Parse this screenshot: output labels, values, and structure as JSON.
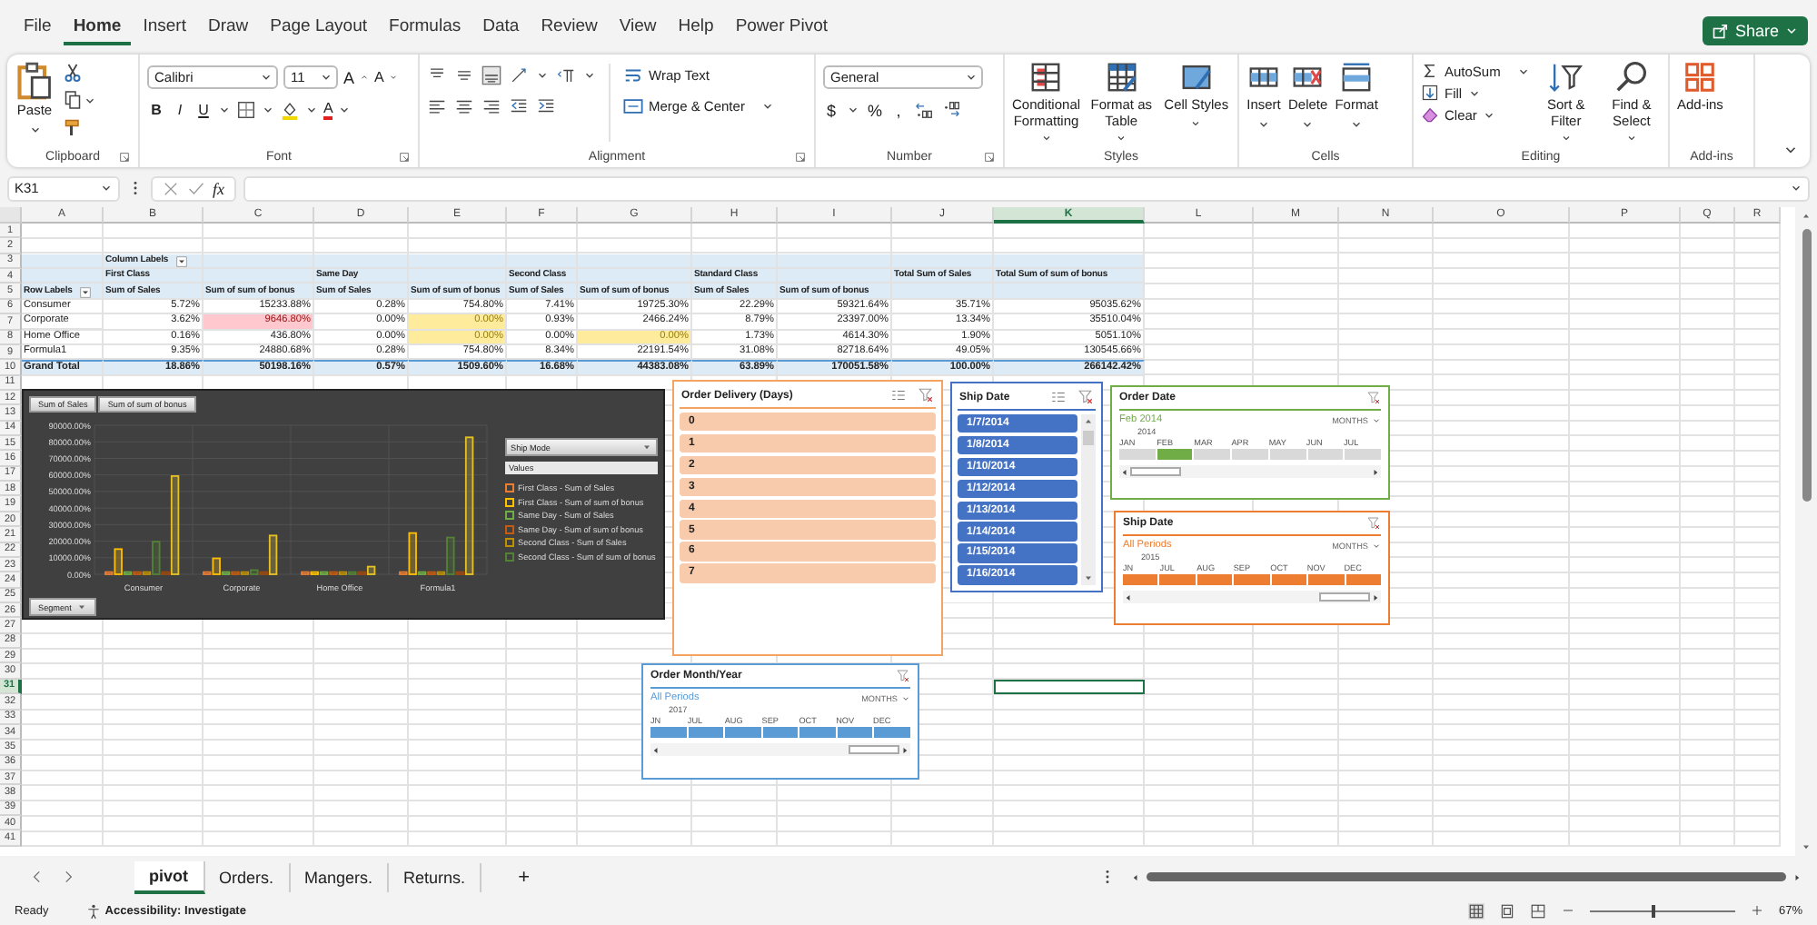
{
  "menu_tabs": [
    {
      "label": "File",
      "selected": false
    },
    {
      "label": "Home",
      "selected": true
    },
    {
      "label": "Insert",
      "selected": false
    },
    {
      "label": "Draw",
      "selected": false
    },
    {
      "label": "Page Layout",
      "selected": false
    },
    {
      "label": "Formulas",
      "selected": false
    },
    {
      "label": "Data",
      "selected": false
    },
    {
      "label": "Review",
      "selected": false
    },
    {
      "label": "View",
      "selected": false
    },
    {
      "label": "Help",
      "selected": false
    },
    {
      "label": "Power Pivot",
      "selected": false
    }
  ],
  "share_button": "Share",
  "ribbon": {
    "clipboard": {
      "paste": "Paste",
      "label": "Clipboard"
    },
    "font": {
      "family": "Calibri",
      "size": "11",
      "grow": "A",
      "shrink": "A",
      "bold": "B",
      "italic": "I",
      "underline": "U",
      "color_letter": "A",
      "label": "Font"
    },
    "alignment": {
      "wrap": "Wrap Text",
      "merge": "Merge & Center",
      "label": "Alignment"
    },
    "number": {
      "format": "General",
      "currency": "$",
      "percent": "%",
      "comma": ",",
      "label": "Number"
    },
    "styles": {
      "buttons": [
        "Conditional Formatting",
        "Format as Table",
        "Cell Styles"
      ],
      "label": "Styles"
    },
    "cells": {
      "buttons": [
        "Insert",
        "Delete",
        "Format"
      ],
      "label": "Cells"
    },
    "editing": {
      "autosum": "AutoSum",
      "fill": "Fill",
      "clear": "Clear",
      "sort": "Sort & Filter",
      "find": "Find & Select",
      "label": "Editing"
    },
    "addins": {
      "button": "Add-ins",
      "label": "Add-ins"
    }
  },
  "formula_bar": {
    "name_box": "K31",
    "function_label": "fx"
  },
  "sheet": {
    "columns": [
      {
        "label": "A",
        "selected": false
      },
      {
        "label": "B",
        "selected": false
      },
      {
        "label": "C",
        "selected": false
      },
      {
        "label": "D",
        "selected": false
      },
      {
        "label": "E",
        "selected": false
      },
      {
        "label": "F",
        "selected": false
      },
      {
        "label": "G",
        "selected": false
      },
      {
        "label": "H",
        "selected": false
      },
      {
        "label": "I",
        "selected": false
      },
      {
        "label": "J",
        "selected": false
      },
      {
        "label": "K",
        "selected": true
      },
      {
        "label": "L",
        "selected": false
      },
      {
        "label": "M",
        "selected": false
      },
      {
        "label": "N",
        "selected": false
      },
      {
        "label": "O",
        "selected": false
      },
      {
        "label": "P",
        "selected": false
      },
      {
        "label": "Q",
        "selected": false
      },
      {
        "label": "R",
        "selected": false
      }
    ],
    "rows": [
      {
        "label": "1",
        "selected": false
      },
      {
        "label": "2",
        "selected": false
      },
      {
        "label": "3",
        "selected": false
      },
      {
        "label": "4",
        "selected": false
      },
      {
        "label": "5",
        "selected": false
      },
      {
        "label": "6",
        "selected": false
      },
      {
        "label": "7",
        "selected": false
      },
      {
        "label": "8",
        "selected": false
      },
      {
        "label": "9",
        "selected": false
      },
      {
        "label": "10",
        "selected": false
      },
      {
        "label": "11",
        "selected": false
      },
      {
        "label": "12",
        "selected": false
      },
      {
        "label": "13",
        "selected": false
      },
      {
        "label": "14",
        "selected": false
      },
      {
        "label": "15",
        "selected": false
      },
      {
        "label": "16",
        "selected": false
      },
      {
        "label": "17",
        "selected": false
      },
      {
        "label": "18",
        "selected": false
      },
      {
        "label": "19",
        "selected": false
      },
      {
        "label": "20",
        "selected": false
      },
      {
        "label": "21",
        "selected": false
      },
      {
        "label": "22",
        "selected": false
      },
      {
        "label": "23",
        "selected": false
      },
      {
        "label": "24",
        "selected": false
      },
      {
        "label": "25",
        "selected": false
      },
      {
        "label": "26",
        "selected": false
      },
      {
        "label": "27",
        "selected": false
      },
      {
        "label": "28",
        "selected": false
      },
      {
        "label": "29",
        "selected": false
      },
      {
        "label": "30",
        "selected": false
      },
      {
        "label": "31",
        "selected": true
      },
      {
        "label": "32",
        "selected": false
      },
      {
        "label": "33",
        "selected": false
      },
      {
        "label": "34",
        "selected": false
      },
      {
        "label": "35",
        "selected": false
      },
      {
        "label": "36",
        "selected": false
      },
      {
        "label": "37",
        "selected": false
      },
      {
        "label": "38",
        "selected": false
      },
      {
        "label": "39",
        "selected": false
      },
      {
        "label": "40",
        "selected": false
      },
      {
        "label": "41",
        "selected": false
      }
    ]
  },
  "pivot": {
    "column_labels": "Column Labels",
    "row_labels": "Row Labels",
    "groups": [
      {
        "name": "First Class",
        "measures": [
          "Sum of Sales",
          "Sum of sum of bonus"
        ]
      },
      {
        "name": "Same Day",
        "measures": [
          "Sum of Sales",
          "Sum of sum of bonus"
        ]
      },
      {
        "name": "Second Class",
        "measures": [
          "Sum of Sales",
          "Sum of sum of bonus"
        ]
      },
      {
        "name": "Standard Class",
        "measures": [
          "Sum of Sales",
          "Sum of sum of bonus"
        ]
      }
    ],
    "totals": [
      "Total Sum of Sales",
      "Total Sum of sum of bonus"
    ],
    "rows": [
      {
        "label": "Consumer",
        "cells": [
          {
            "value": "5.72%",
            "color": "#ffffff"
          },
          {
            "value": "15233.88%",
            "color": "#ffffff"
          },
          {
            "value": "0.28%",
            "color": "#ffffff"
          },
          {
            "value": "754.80%",
            "color": "#ffffff"
          },
          {
            "value": "7.41%",
            "color": "#ffffff"
          },
          {
            "value": "19725.30%",
            "color": "#ffffff"
          },
          {
            "value": "22.29%",
            "color": "#ffffff"
          },
          {
            "value": "59321.64%",
            "color": "#ffffff"
          },
          {
            "value": "35.71%",
            "color": "#ffffff"
          },
          {
            "value": "95035.62%",
            "color": "#ffffff"
          }
        ]
      },
      {
        "label": "Corporate",
        "cells": [
          {
            "value": "3.62%",
            "color": "#ffffff"
          },
          {
            "value": "9646.80%",
            "color": "#ffc7ce"
          },
          {
            "value": "0.00%",
            "color": "#ffffff"
          },
          {
            "value": "0.00%",
            "color": "#ffeb9c"
          },
          {
            "value": "0.93%",
            "color": "#ffffff"
          },
          {
            "value": "2466.24%",
            "color": "#ffffff"
          },
          {
            "value": "8.79%",
            "color": "#ffffff"
          },
          {
            "value": "23397.00%",
            "color": "#ffffff"
          },
          {
            "value": "13.34%",
            "color": "#ffffff"
          },
          {
            "value": "35510.04%",
            "color": "#ffffff"
          }
        ]
      },
      {
        "label": "Home Office",
        "cells": [
          {
            "value": "0.16%",
            "color": "#ffffff"
          },
          {
            "value": "436.80%",
            "color": "#ffffff"
          },
          {
            "value": "0.00%",
            "color": "#ffffff"
          },
          {
            "value": "0.00%",
            "color": "#ffeb9c"
          },
          {
            "value": "0.00%",
            "color": "#ffffff"
          },
          {
            "value": "0.00%",
            "color": "#ffeb9c"
          },
          {
            "value": "1.73%",
            "color": "#ffffff"
          },
          {
            "value": "4614.30%",
            "color": "#ffffff"
          },
          {
            "value": "1.90%",
            "color": "#ffffff"
          },
          {
            "value": "5051.10%",
            "color": "#ffffff"
          }
        ]
      },
      {
        "label": "Formula1",
        "cells": [
          {
            "value": "9.35%",
            "color": "#ffffff"
          },
          {
            "value": "24880.68%",
            "color": "#ffffff"
          },
          {
            "value": "0.28%",
            "color": "#ffffff"
          },
          {
            "value": "754.80%",
            "color": "#ffffff"
          },
          {
            "value": "8.34%",
            "color": "#ffffff"
          },
          {
            "value": "22191.54%",
            "color": "#ffffff"
          },
          {
            "value": "31.08%",
            "color": "#ffffff"
          },
          {
            "value": "82718.64%",
            "color": "#ffffff"
          },
          {
            "value": "49.05%",
            "color": "#ffffff"
          },
          {
            "value": "130545.66%",
            "color": "#ffffff"
          }
        ]
      }
    ],
    "grand_total": {
      "label": "Grand Total",
      "values": [
        "18.86%",
        "50198.16%",
        "0.57%",
        "1509.60%",
        "16.68%",
        "44383.08%",
        "63.89%",
        "170051.58%",
        "100.00%",
        "266142.42%"
      ]
    }
  },
  "pivot_chart": {
    "value_buttons": [
      "Sum of Sales",
      "Sum of sum of bonus"
    ],
    "legend_field": "Ship Mode",
    "legend_values": "Values",
    "axis_button": "Segment",
    "chart_data": {
      "type": "bar",
      "grid": true,
      "categories": [
        "Consumer",
        "Corporate",
        "Home Office",
        "Formula1"
      ],
      "ylim": [
        0,
        90000
      ],
      "yticks": [
        {
          "value": 0,
          "label": "0.00%"
        },
        {
          "value": 10000,
          "label": "10000.00%"
        },
        {
          "value": 20000,
          "label": "20000.00%"
        },
        {
          "value": 30000,
          "label": "30000.00%"
        },
        {
          "value": 40000,
          "label": "40000.00%"
        },
        {
          "value": 50000,
          "label": "50000.00%"
        },
        {
          "value": 60000,
          "label": "60000.00%"
        },
        {
          "value": 70000,
          "label": "70000.00%"
        },
        {
          "value": 80000,
          "label": "80000.00%"
        },
        {
          "value": 90000,
          "label": "90000.00%"
        }
      ],
      "series": [
        {
          "name": "First Class - Sum of Sales",
          "color": "#ed7d31",
          "values": [
            6,
            4,
            0,
            9
          ]
        },
        {
          "name": "First Class - Sum of sum of bonus",
          "color": "#ffc000",
          "values": [
            15200,
            9600,
            400,
            24900
          ]
        },
        {
          "name": "Same Day - Sum of Sales",
          "color": "#70ad47",
          "values": [
            0,
            0,
            0,
            0
          ]
        },
        {
          "name": "Same Day - Sum of sum of bonus",
          "color": "#c55a11",
          "values": [
            800,
            0,
            0,
            800
          ]
        },
        {
          "name": "Second Class - Sum of Sales",
          "color": "#bf9000",
          "values": [
            7,
            1,
            0,
            8
          ]
        },
        {
          "name": "Second Class - Sum of sum of bonus",
          "color": "#548235",
          "values": [
            19700,
            2500,
            0,
            22200
          ]
        },
        {
          "color": "#9e480e",
          "values": [
            22,
            9,
            2,
            31
          ]
        },
        {
          "color": "#e6c229",
          "values": [
            59300,
            23400,
            4600,
            82700
          ]
        }
      ]
    }
  },
  "slicers": [
    {
      "title": "Order Delivery (Days)",
      "color": "#f4a460",
      "scrollable": false,
      "items": [
        {
          "label": "0",
          "selected": true,
          "color": "#f8cbad"
        },
        {
          "label": "1",
          "selected": true,
          "color": "#f8cbad"
        },
        {
          "label": "2",
          "selected": true,
          "color": "#f8cbad"
        },
        {
          "label": "3",
          "selected": true,
          "color": "#f8cbad"
        },
        {
          "label": "4",
          "selected": true,
          "color": "#f8cbad"
        },
        {
          "label": "5",
          "selected": true,
          "color": "#f8cbad"
        },
        {
          "label": "6",
          "selected": true,
          "color": "#f8cbad"
        },
        {
          "label": "7",
          "selected": true,
          "color": "#f8cbad"
        }
      ]
    },
    {
      "title": "Ship Date",
      "color": "#4472c4",
      "scrollable": true,
      "items": [
        {
          "label": "1/7/2014",
          "selected": true,
          "color": "#4472c4"
        },
        {
          "label": "1/8/2014",
          "selected": true,
          "color": "#4472c4"
        },
        {
          "label": "1/10/2014",
          "selected": true,
          "color": "#4472c4"
        },
        {
          "label": "1/12/2014",
          "selected": true,
          "color": "#4472c4"
        },
        {
          "label": "1/13/2014",
          "selected": true,
          "color": "#4472c4"
        },
        {
          "label": "1/14/2014",
          "selected": true,
          "color": "#4472c4"
        },
        {
          "label": "1/15/2014",
          "selected": true,
          "color": "#4472c4"
        },
        {
          "label": "1/16/2014",
          "selected": true,
          "color": "#4472c4"
        }
      ]
    }
  ],
  "timelines": [
    {
      "title": "Order Date",
      "color": "#70ad47",
      "selection": "Feb 2014",
      "level": "MONTHS",
      "year": "2014",
      "months": [
        {
          "label": "JAN",
          "selected": false
        },
        {
          "label": "FEB",
          "selected": true
        },
        {
          "label": "MAR",
          "selected": false
        },
        {
          "label": "APR",
          "selected": false
        },
        {
          "label": "MAY",
          "selected": false
        },
        {
          "label": "JUN",
          "selected": false
        },
        {
          "label": "JUL",
          "selected": false
        }
      ]
    },
    {
      "title": "Ship Date",
      "color": "#ed7d31",
      "selection": "All Periods",
      "level": "MONTHS",
      "year": "2015",
      "months": [
        {
          "label": "JN",
          "selected": true
        },
        {
          "label": "JUL",
          "selected": true
        },
        {
          "label": "AUG",
          "selected": true
        },
        {
          "label": "SEP",
          "selected": true
        },
        {
          "label": "OCT",
          "selected": true
        },
        {
          "label": "NOV",
          "selected": true
        },
        {
          "label": "DEC",
          "selected": true
        }
      ]
    },
    {
      "title": "Order Month/Year",
      "color": "#5b9bd5",
      "selection": "All Periods",
      "level": "MONTHS",
      "year": "2017",
      "months": [
        {
          "label": "JN",
          "selected": true
        },
        {
          "label": "JUL",
          "selected": true
        },
        {
          "label": "AUG",
          "selected": true
        },
        {
          "label": "SEP",
          "selected": true
        },
        {
          "label": "OCT",
          "selected": true
        },
        {
          "label": "NOV",
          "selected": true
        },
        {
          "label": "DEC",
          "selected": true
        }
      ]
    }
  ],
  "sheet_tabs": [
    {
      "label": "pivot",
      "selected": true
    },
    {
      "label": "Orders.",
      "selected": false
    },
    {
      "label": "Mangers.",
      "selected": false
    },
    {
      "label": "Returns.",
      "selected": false
    }
  ],
  "new_sheet": "+",
  "status_bar": {
    "mode": "Ready",
    "accessibility": "Accessibility: Investigate",
    "zoom_slider": {
      "level": 0.43
    },
    "zoom": "67%"
  }
}
